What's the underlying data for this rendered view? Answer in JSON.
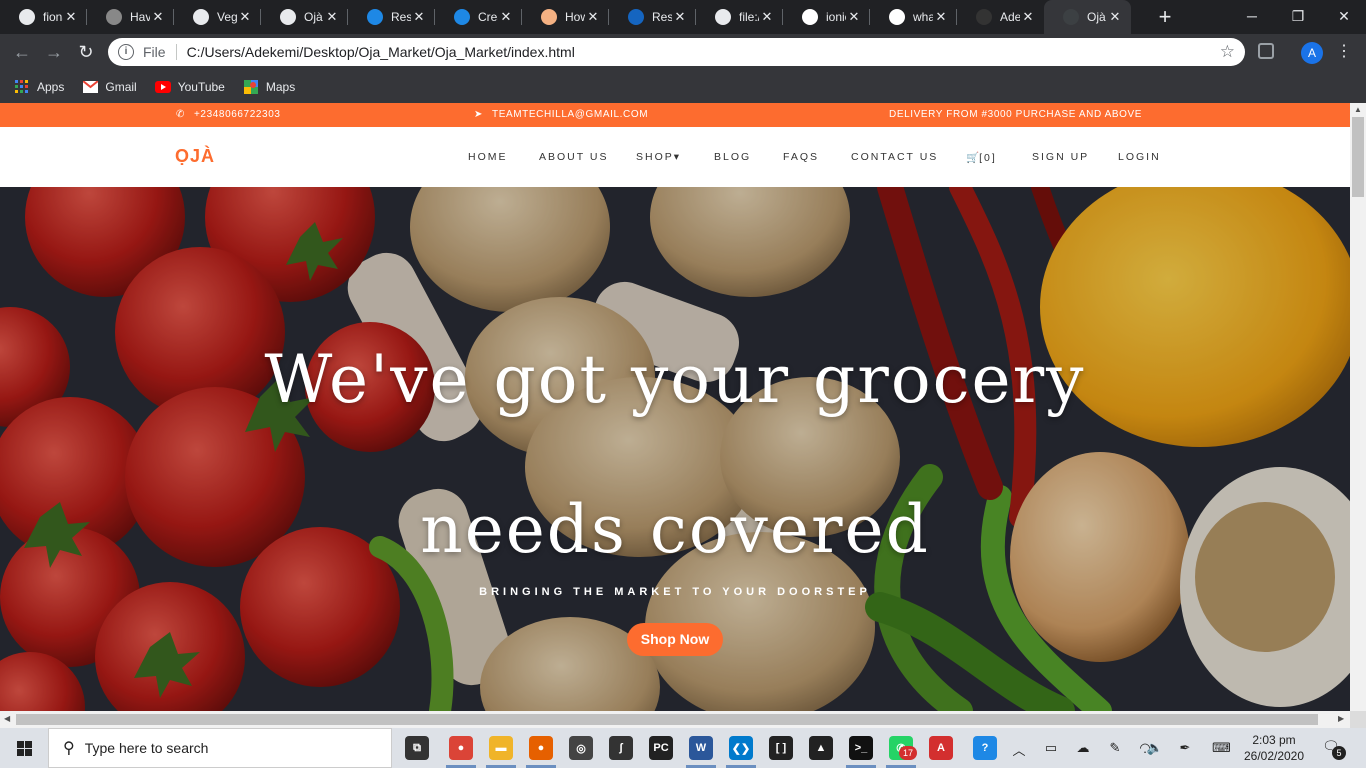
{
  "browser": {
    "tabs": [
      {
        "title": "fiona",
        "icon": "github-icon",
        "color": "#e8eaed"
      },
      {
        "title": "Have",
        "icon": "stackoverflow-icon",
        "color": "#888888"
      },
      {
        "title": "Vege",
        "icon": "globe-icon",
        "color": "#e8eaed"
      },
      {
        "title": "Ojà",
        "icon": "globe-icon",
        "color": "#e8eaed"
      },
      {
        "title": "Resu",
        "icon": "resume-icon",
        "color": "#1e88e5"
      },
      {
        "title": "Crea",
        "icon": "resume-icon",
        "color": "#1e88e5"
      },
      {
        "title": "How",
        "icon": "hand-icon",
        "color": "#f4b183"
      },
      {
        "title": "Resu",
        "icon": "canva-icon",
        "color": "#1565c0"
      },
      {
        "title": "file:/",
        "icon": "globe-icon",
        "color": "#e8eaed"
      },
      {
        "title": "ionic",
        "icon": "google-icon",
        "color": "#ffffff"
      },
      {
        "title": "what",
        "icon": "google-icon",
        "color": "#ffffff"
      },
      {
        "title": "Adek",
        "icon": "github-icon",
        "color": "#333333"
      },
      {
        "title": "Ojà |",
        "icon": "globe-icon",
        "color": "#3c4043"
      }
    ],
    "active_tab": 12,
    "new_tab_glyph": "+",
    "address": {
      "protocol": "File",
      "url": "C:/Users/Adekemi/Desktop/Oja_Market/Oja_Market/index.html"
    },
    "profile_initial": "A",
    "bookmarks": [
      {
        "label": "Apps",
        "icon": "apps-grid-icon"
      },
      {
        "label": "Gmail",
        "icon": "gmail-icon"
      },
      {
        "label": "YouTube",
        "icon": "youtube-icon"
      },
      {
        "label": "Maps",
        "icon": "maps-icon"
      }
    ]
  },
  "site": {
    "accent": "#fd6c2f",
    "topbar": {
      "phone": "+2348066722303",
      "email": "TEAMTECHILLA@GMAIL.COM",
      "delivery": "DELIVERY FROM #3000 PURCHASE AND ABOVE"
    },
    "brand": "ỌJÀ",
    "nav": {
      "home": "HOME",
      "about": "ABOUT US",
      "shop": "SHOP",
      "shop_caret": "▾",
      "blog": "BLOG",
      "faqs": "FAQS",
      "contact": "CONTACT US",
      "cart": "[0]",
      "signup": "SIGN UP",
      "login": "LOGIN"
    },
    "hero": {
      "title": "We've got your grocery needs covered",
      "subtitle": "BRINGING THE MARKET TO YOUR DOORSTEP",
      "cta": "Shop Now"
    }
  },
  "taskbar": {
    "search_placeholder": "Type here to search",
    "time": "2:03 pm",
    "date": "26/02/2020",
    "notification_count": "5",
    "whatsapp_badge": "17",
    "apps": [
      {
        "name": "task-view-icon",
        "color": "#333333",
        "glyph": "⧉"
      },
      {
        "name": "chrome-icon",
        "color": "#db4437",
        "glyph": "●"
      },
      {
        "name": "file-explorer-icon",
        "color": "#f0b429",
        "glyph": "▬"
      },
      {
        "name": "firefox-icon",
        "color": "#e66000",
        "glyph": "●"
      },
      {
        "name": "obs-icon",
        "color": "#444444",
        "glyph": "◎"
      },
      {
        "name": "excel-like-icon",
        "color": "#333333",
        "glyph": "ʃ"
      },
      {
        "name": "pycharm-icon",
        "color": "#222222",
        "glyph": "PC"
      },
      {
        "name": "word-icon",
        "color": "#2b579a",
        "glyph": "W"
      },
      {
        "name": "vscode-icon",
        "color": "#007acc",
        "glyph": "❮❯"
      },
      {
        "name": "brackets-icon",
        "color": "#222222",
        "glyph": "[ ]"
      },
      {
        "name": "photos-icon",
        "color": "#222222",
        "glyph": "▲"
      },
      {
        "name": "terminal-icon",
        "color": "#111111",
        "glyph": ">_"
      },
      {
        "name": "whatsapp-icon",
        "color": "#25d366",
        "glyph": "✆"
      },
      {
        "name": "acrobat-icon",
        "color": "#d32f2f",
        "glyph": "A"
      },
      {
        "name": "help-icon",
        "color": "#1e88e5",
        "glyph": "?"
      }
    ]
  }
}
